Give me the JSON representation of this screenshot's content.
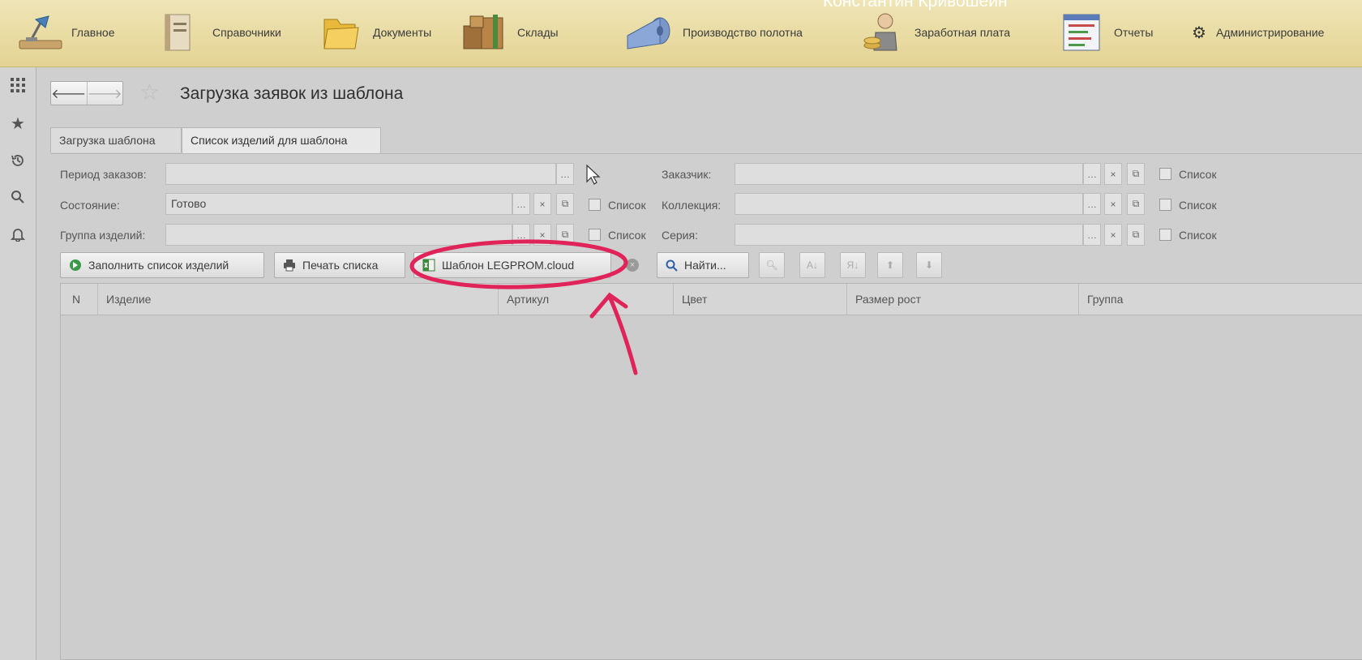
{
  "user": {
    "name": "Константин Кривошеин"
  },
  "menu": [
    {
      "label": "Главное",
      "icon": "desk-lamp-icon"
    },
    {
      "label": "Справочники",
      "icon": "reference-book-icon"
    },
    {
      "label": "Документы",
      "icon": "folder-icon"
    },
    {
      "label": "Склады",
      "icon": "warehouse-boxes-icon"
    },
    {
      "label": "Производство полотна",
      "icon": "fabric-roll-icon"
    },
    {
      "label": "Заработная плата",
      "icon": "salary-worker-icon"
    },
    {
      "label": "Отчеты",
      "icon": "report-chart-icon"
    },
    {
      "label": "Администрирование",
      "icon": "gear-icon"
    }
  ],
  "sidebar": {
    "icons": [
      "apps-grid-icon",
      "favorites-star-icon",
      "history-icon",
      "search-icon",
      "notifications-bell-icon"
    ]
  },
  "page": {
    "title": "Загрузка заявок из шаблона"
  },
  "tabs": [
    {
      "label": "Загрузка шаблона",
      "active": false
    },
    {
      "label": "Список изделий для шаблона",
      "active": true
    }
  ],
  "filters": {
    "period": {
      "label": "Период заказов:",
      "value": ""
    },
    "state": {
      "label": "Состояние:",
      "value": "Готово",
      "list_label": "Список"
    },
    "group": {
      "label": "Группа изделий:",
      "value": "",
      "list_label": "Список"
    },
    "customer": {
      "label": "Заказчик:",
      "value": "",
      "list_label": "Список"
    },
    "collection": {
      "label": "Коллекция:",
      "value": "",
      "list_label": "Список"
    },
    "series": {
      "label": "Серия:",
      "value": "",
      "list_label": "Список"
    }
  },
  "toolbar": {
    "fill": "Заполнить список изделий",
    "print": "Печать списка",
    "template": "Шаблон LEGPROM.cloud",
    "find": "Найти..."
  },
  "table": {
    "columns": [
      "N",
      "Изделие",
      "Артикул",
      "Цвет",
      "Размер рост",
      "Группа"
    ],
    "rows": []
  },
  "colors": {
    "topbar": "#e6d89b",
    "annotation": "#e0245a"
  }
}
